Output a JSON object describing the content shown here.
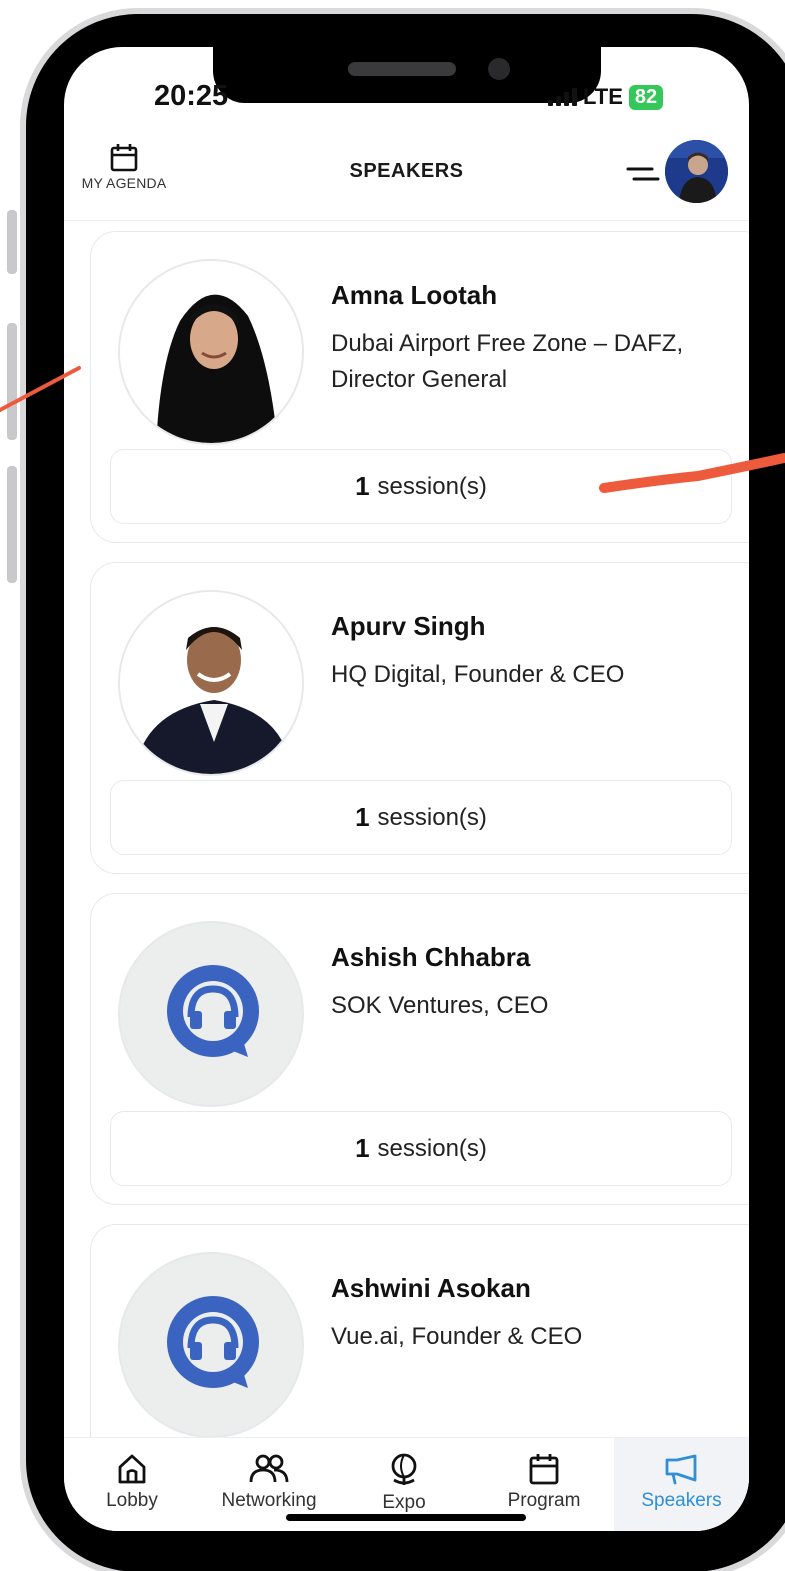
{
  "status_bar": {
    "time": "20:25",
    "network": "LTE",
    "battery": "82"
  },
  "header": {
    "agenda_label": "MY AGENDA",
    "title": "SPEAKERS"
  },
  "speakers": [
    {
      "name": "Amna Lootah",
      "role": "Dubai Airport Free Zone – DAFZ, Director General",
      "sessions": "1",
      "sessions_label": "session(s)",
      "photo": "photo"
    },
    {
      "name": "Apurv Singh",
      "role": "HQ Digital, Founder & CEO",
      "sessions": "1",
      "sessions_label": "session(s)",
      "photo": "photo"
    },
    {
      "name": "Ashish Chhabra",
      "role": "SOK Ventures, CEO",
      "sessions": "1",
      "sessions_label": "session(s)",
      "photo": "placeholder-headset-icon"
    },
    {
      "name": "Ashwini Asokan",
      "role": "Vue.ai, Founder & CEO",
      "sessions": "",
      "sessions_label": "",
      "photo": "placeholder-headset-icon"
    }
  ],
  "tabs": [
    {
      "label": "Lobby",
      "icon": "home-icon",
      "active": false
    },
    {
      "label": "Networking",
      "icon": "people-icon",
      "active": false
    },
    {
      "label": "Expo",
      "icon": "globe-icon",
      "active": false
    },
    {
      "label": "Program",
      "icon": "calendar-icon",
      "active": false
    },
    {
      "label": "Speakers",
      "icon": "megaphone-icon",
      "active": true
    }
  ],
  "colors": {
    "active_tab": "#2e8fd8",
    "placeholder_icon": "#3b64c0",
    "annotation": "#ee5a3c",
    "battery": "#34c759"
  }
}
